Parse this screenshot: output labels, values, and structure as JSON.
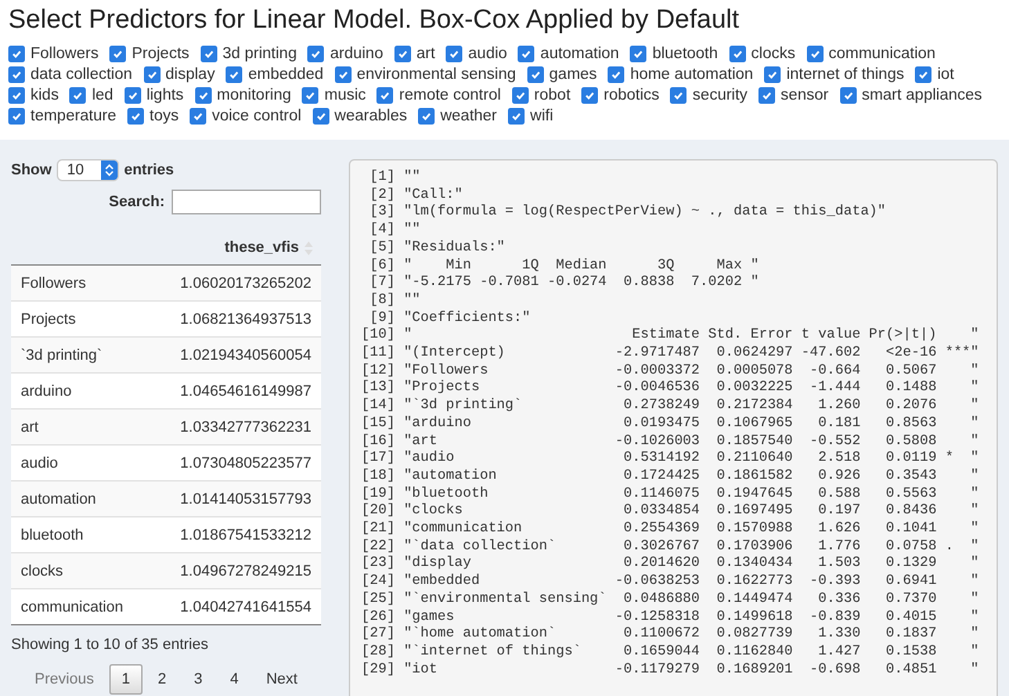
{
  "title": "Select Predictors for Linear Model. Box-Cox Applied by Default",
  "predictors": [
    {
      "label": "Followers",
      "checked": true
    },
    {
      "label": "Projects",
      "checked": true
    },
    {
      "label": "3d printing",
      "checked": true
    },
    {
      "label": "arduino",
      "checked": true
    },
    {
      "label": "art",
      "checked": true
    },
    {
      "label": "audio",
      "checked": true
    },
    {
      "label": "automation",
      "checked": true
    },
    {
      "label": "bluetooth",
      "checked": true
    },
    {
      "label": "clocks",
      "checked": true
    },
    {
      "label": "communication",
      "checked": true
    },
    {
      "label": "data collection",
      "checked": true
    },
    {
      "label": "display",
      "checked": true
    },
    {
      "label": "embedded",
      "checked": true
    },
    {
      "label": "environmental sensing",
      "checked": true
    },
    {
      "label": "games",
      "checked": true
    },
    {
      "label": "home automation",
      "checked": true
    },
    {
      "label": "internet of things",
      "checked": true
    },
    {
      "label": "iot",
      "checked": true
    },
    {
      "label": "kids",
      "checked": true
    },
    {
      "label": "led",
      "checked": true
    },
    {
      "label": "lights",
      "checked": true
    },
    {
      "label": "monitoring",
      "checked": true
    },
    {
      "label": "music",
      "checked": true
    },
    {
      "label": "remote control",
      "checked": true
    },
    {
      "label": "robot",
      "checked": true
    },
    {
      "label": "robotics",
      "checked": true
    },
    {
      "label": "security",
      "checked": true
    },
    {
      "label": "sensor",
      "checked": true
    },
    {
      "label": "smart appliances",
      "checked": true
    },
    {
      "label": "temperature",
      "checked": true
    },
    {
      "label": "toys",
      "checked": true
    },
    {
      "label": "voice control",
      "checked": true
    },
    {
      "label": "wearables",
      "checked": true
    },
    {
      "label": "weather",
      "checked": true
    },
    {
      "label": "wifi",
      "checked": true
    }
  ],
  "table_controls": {
    "show_label": "Show",
    "page_length": "10",
    "entries_label": "entries",
    "search_label": "Search:"
  },
  "table": {
    "value_column": "these_vfis",
    "rows": [
      {
        "name": "Followers",
        "value": "1.06020173265202"
      },
      {
        "name": "Projects",
        "value": "1.06821364937513"
      },
      {
        "name": "`3d printing`",
        "value": "1.02194340560054"
      },
      {
        "name": "arduino",
        "value": "1.04654616149987"
      },
      {
        "name": "art",
        "value": "1.03342777362231"
      },
      {
        "name": "audio",
        "value": "1.07304805223577"
      },
      {
        "name": "automation",
        "value": "1.01414053157793"
      },
      {
        "name": "bluetooth",
        "value": "1.01867541533212"
      },
      {
        "name": "clocks",
        "value": "1.04967278249215"
      },
      {
        "name": "communication",
        "value": "1.04042741641554"
      }
    ]
  },
  "info": "Showing 1 to 10 of 35 entries",
  "pagination": {
    "previous": {
      "label": "Previous",
      "disabled": true
    },
    "pages": [
      {
        "label": "1",
        "selected": true
      },
      {
        "label": "2",
        "selected": false
      },
      {
        "label": "3",
        "selected": false
      },
      {
        "label": "4",
        "selected": false
      }
    ],
    "next": {
      "label": "Next",
      "disabled": false
    }
  },
  "output": {
    "lines": [
      {
        "index": "[1]",
        "text": "\"\""
      },
      {
        "index": "[2]",
        "text": "\"Call:\""
      },
      {
        "index": "[3]",
        "text": "\"lm(formula = log(RespectPerView) ~ ., data = this_data)\""
      },
      {
        "index": "[4]",
        "text": "\"\""
      },
      {
        "index": "[5]",
        "text": "\"Residuals:\""
      },
      {
        "index": "[6]",
        "text": "\"    Min      1Q  Median      3Q     Max \""
      },
      {
        "index": "[7]",
        "text": "\"-5.2175 -0.7081 -0.0274  0.8838  7.0202 \""
      },
      {
        "index": "[8]",
        "text": "\"\""
      },
      {
        "index": "[9]",
        "text": "\"Coefficients:\""
      },
      {
        "index": "[10]",
        "text": "\"                          Estimate Std. Error t value Pr(>|t|)    \""
      },
      {
        "index": "[11]",
        "text": "\"(Intercept)             -2.9717487  0.0624297 -47.602   <2e-16 ***\""
      },
      {
        "index": "[12]",
        "text": "\"Followers               -0.0003372  0.0005078  -0.664   0.5067    \""
      },
      {
        "index": "[13]",
        "text": "\"Projects                -0.0046536  0.0032225  -1.444   0.1488    \""
      },
      {
        "index": "[14]",
        "text": "\"`3d printing`            0.2738249  0.2172384   1.260   0.2076    \""
      },
      {
        "index": "[15]",
        "text": "\"arduino                  0.0193475  0.1067965   0.181   0.8563    \""
      },
      {
        "index": "[16]",
        "text": "\"art                     -0.1026003  0.1857540  -0.552   0.5808    \""
      },
      {
        "index": "[17]",
        "text": "\"audio                    0.5314192  0.2110640   2.518   0.0119 *  \""
      },
      {
        "index": "[18]",
        "text": "\"automation               0.1724425  0.1861582   0.926   0.3543    \""
      },
      {
        "index": "[19]",
        "text": "\"bluetooth                0.1146075  0.1947645   0.588   0.5563    \""
      },
      {
        "index": "[20]",
        "text": "\"clocks                   0.0334854  0.1697495   0.197   0.8436    \""
      },
      {
        "index": "[21]",
        "text": "\"communication            0.2554369  0.1570988   1.626   0.1041    \""
      },
      {
        "index": "[22]",
        "text": "\"`data collection`        0.3026767  0.1703906   1.776   0.0758 .  \""
      },
      {
        "index": "[23]",
        "text": "\"display                  0.2014620  0.1340434   1.503   0.1329    \""
      },
      {
        "index": "[24]",
        "text": "\"embedded                -0.0638253  0.1622773  -0.393   0.6941    \""
      },
      {
        "index": "[25]",
        "text": "\"`environmental sensing`  0.0486880  0.1449474   0.336   0.7370    \""
      },
      {
        "index": "[26]",
        "text": "\"games                   -0.1258318  0.1499618  -0.839   0.4015    \""
      },
      {
        "index": "[27]",
        "text": "\"`home automation`        0.1100672  0.0827739   1.330   0.1837    \""
      },
      {
        "index": "[28]",
        "text": "\"`internet of things`     0.1659044  0.1162840   1.427   0.1538    \""
      },
      {
        "index": "[29]",
        "text": "\"iot                     -0.1179279  0.1689201  -0.698   0.4851    \""
      }
    ]
  }
}
